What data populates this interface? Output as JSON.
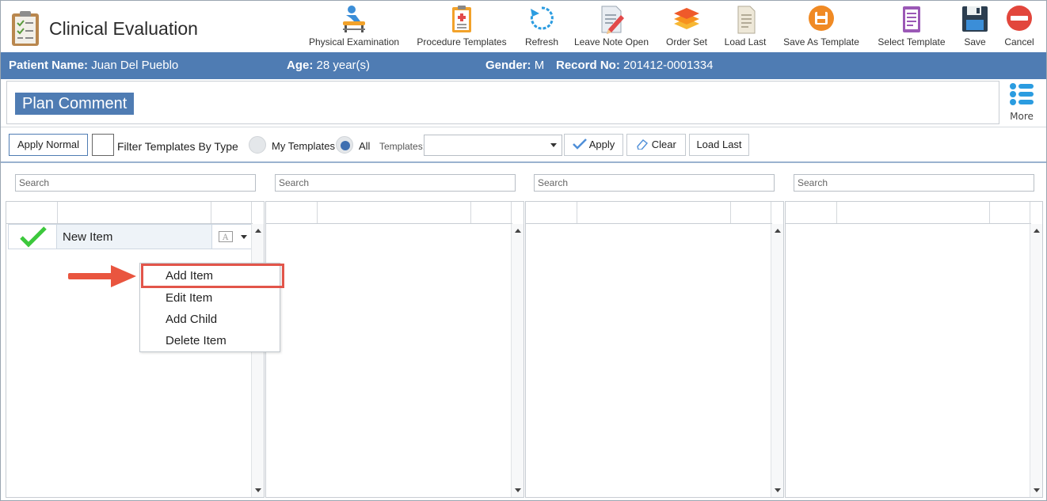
{
  "app": {
    "title": "Clinical Evaluation"
  },
  "toolbar": [
    {
      "label": "Physical Examination",
      "icon": "physical-exam-icon"
    },
    {
      "label": "Procedure Templates",
      "icon": "clipboard-icon"
    },
    {
      "label": "Refresh",
      "icon": "refresh-icon"
    },
    {
      "label": "Leave Note Open",
      "icon": "note-pencil-icon"
    },
    {
      "label": "Order Set",
      "icon": "layers-icon"
    },
    {
      "label": "Load Last",
      "icon": "document-icon"
    },
    {
      "label": "Save As Template",
      "icon": "save-template-icon"
    },
    {
      "label": "Select Template",
      "icon": "template-list-icon"
    },
    {
      "label": "Save",
      "icon": "floppy-disk-icon"
    },
    {
      "label": "Cancel",
      "icon": "cancel-icon"
    }
  ],
  "patient": {
    "name_label": "Patient Name:",
    "name": "Juan Del Pueblo",
    "age_label": "Age:",
    "age": "28 year(s)",
    "gender_label": "Gender:",
    "gender": "M",
    "record_label": "Record No:",
    "record": "201412-0001334"
  },
  "plan": {
    "title": "Plan Comment",
    "more_label": "More"
  },
  "filter": {
    "apply_normal": "Apply Normal",
    "filter_by_type": "Filter Templates By Type",
    "my_templates": "My Templates",
    "all": "All",
    "templates_label": "Templates:",
    "templates_value": "",
    "apply": "Apply",
    "clear": "Clear",
    "load_last": "Load Last",
    "selected_scope": "All"
  },
  "columns": [
    {
      "search_placeholder": "Search"
    },
    {
      "search_placeholder": "Search"
    },
    {
      "search_placeholder": "Search"
    },
    {
      "search_placeholder": "Search"
    }
  ],
  "items": [
    {
      "label": "New Item",
      "checked": true
    }
  ],
  "context_menu": {
    "items": [
      "Add Item",
      "Edit Item",
      "Add Child",
      "Delete Item"
    ],
    "highlighted": "Add Item"
  },
  "colors": {
    "accent": "#4f7cb3",
    "highlight": "#e2554a",
    "check": "#3cc83c"
  }
}
